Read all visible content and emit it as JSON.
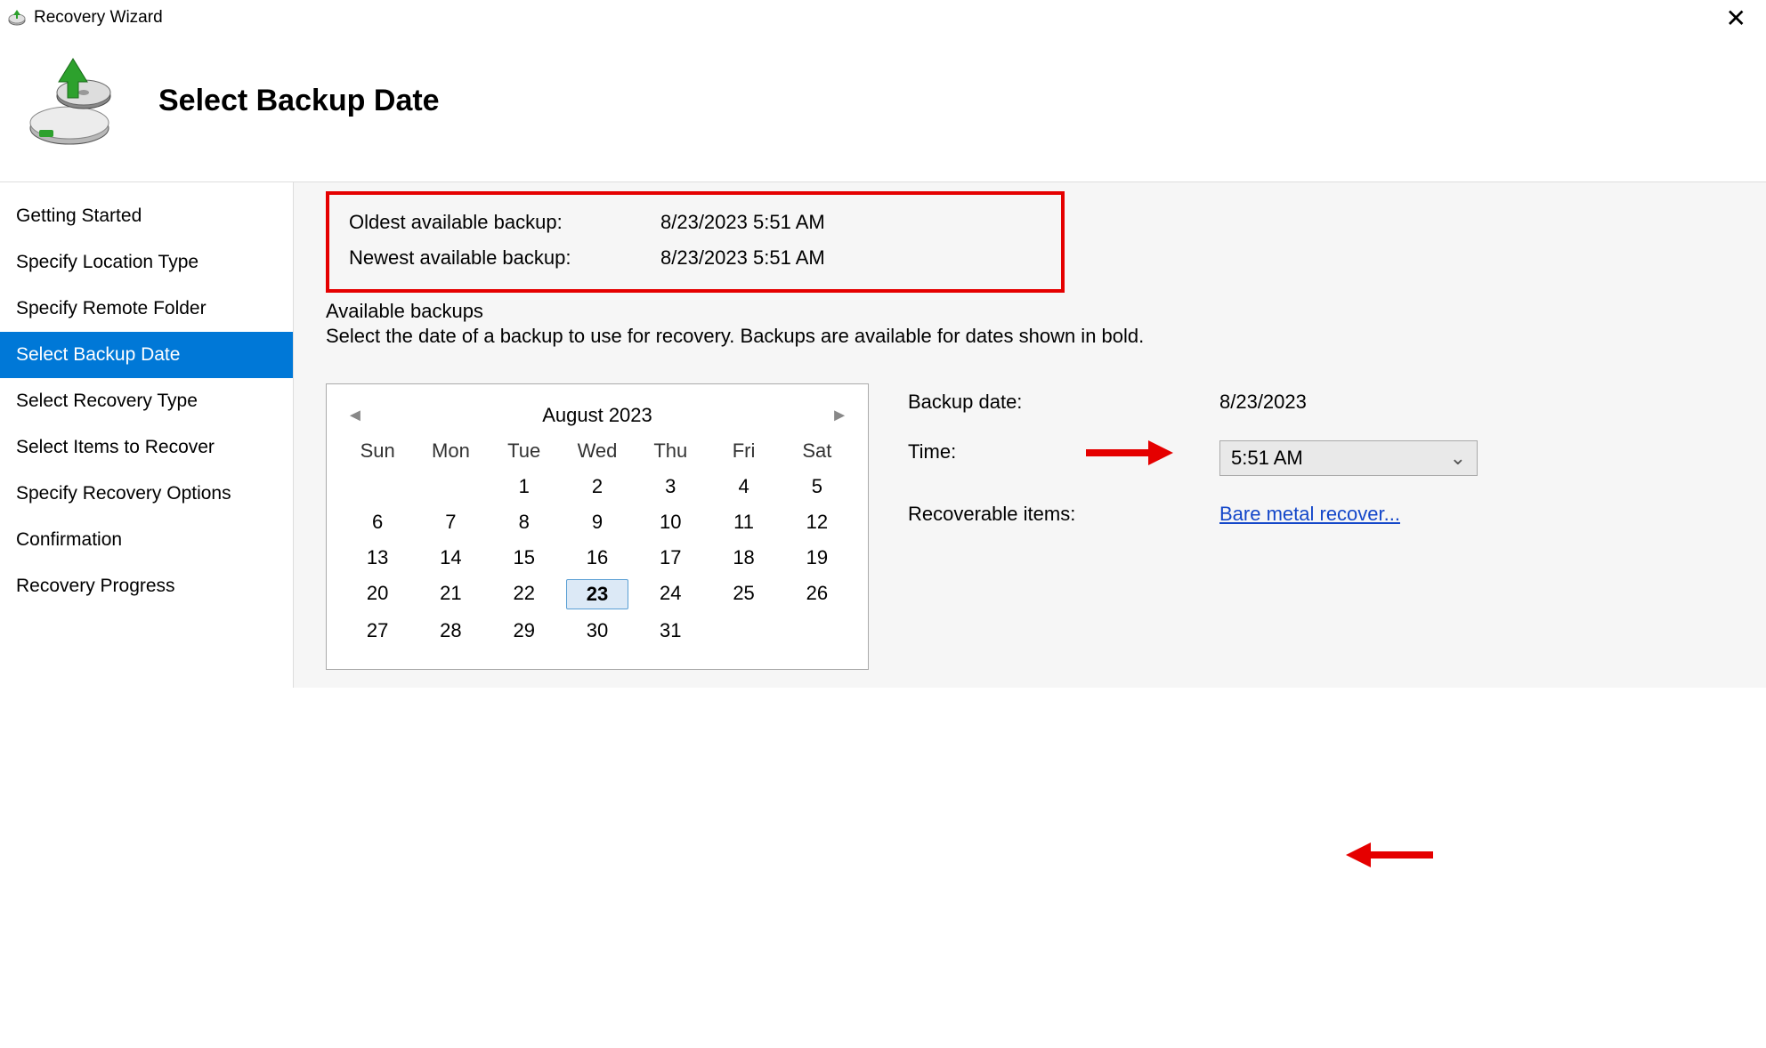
{
  "window": {
    "title": "Recovery Wizard",
    "page_title": "Select Backup Date"
  },
  "sidebar": {
    "items": [
      {
        "label": "Getting Started",
        "selected": false
      },
      {
        "label": "Specify Location Type",
        "selected": false
      },
      {
        "label": "Specify Remote Folder",
        "selected": false
      },
      {
        "label": "Select Backup Date",
        "selected": true
      },
      {
        "label": "Select Recovery Type",
        "selected": false
      },
      {
        "label": "Select Items to Recover",
        "selected": false
      },
      {
        "label": "Specify Recovery Options",
        "selected": false
      },
      {
        "label": "Confirmation",
        "selected": false
      },
      {
        "label": "Recovery Progress",
        "selected": false
      }
    ]
  },
  "info": {
    "oldest_label": "Oldest available backup:",
    "oldest_value": "8/23/2023 5:51 AM",
    "newest_label": "Newest available backup:",
    "newest_value": "8/23/2023 5:51 AM"
  },
  "group": {
    "title": "Available backups",
    "desc": "Select the date of a backup to use for recovery. Backups are available for dates shown in bold."
  },
  "calendar": {
    "month_label": "August 2023",
    "dow": [
      "Sun",
      "Mon",
      "Tue",
      "Wed",
      "Thu",
      "Fri",
      "Sat"
    ],
    "leading_blanks": 2,
    "days": 31,
    "selected_day": 23,
    "bold_days": [
      23
    ]
  },
  "details": {
    "backup_date_label": "Backup date:",
    "backup_date_value": "8/23/2023",
    "time_label": "Time:",
    "time_value": "5:51 AM",
    "recoverable_label": "Recoverable items:",
    "recoverable_link": "Bare metal recover..."
  },
  "annotations": {
    "color": "#e50000"
  }
}
